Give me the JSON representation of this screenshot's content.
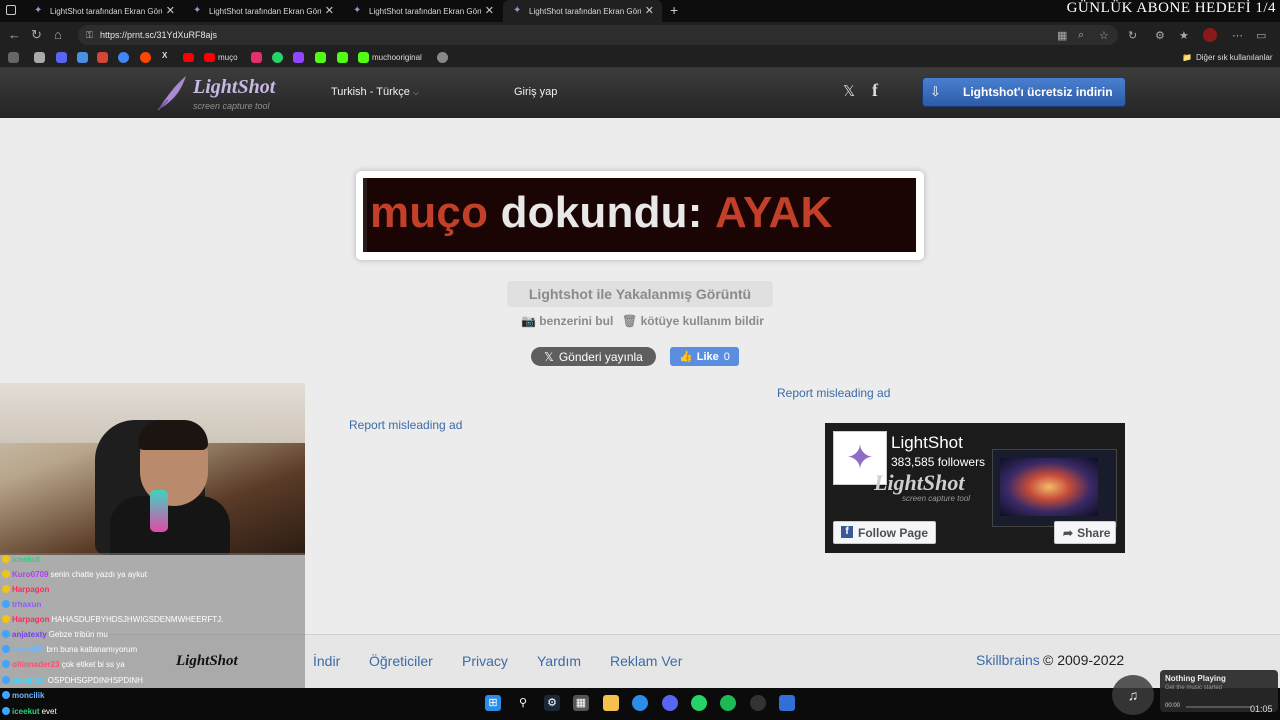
{
  "browser": {
    "tabs": [
      {
        "label": "LightShot tarafından Ekran Görün"
      },
      {
        "label": "LightShot tarafından Ekran Görün"
      },
      {
        "label": "LightShot tarafından Ekran Görün"
      },
      {
        "label": "LightShot tarafından Ekran Görün"
      }
    ],
    "active_tab": 3,
    "url": "https://prnt.sc/31YdXuRF8ajs",
    "bookmarks": [
      {
        "label": "muço"
      },
      {
        "label": "muchooriginal"
      }
    ],
    "other_bookmarks": "Diğer sık kullanılanlar"
  },
  "overlay": {
    "subscriber_goal": "GÜNLÜK ABONE HEDEFİ 1/4"
  },
  "header": {
    "logo_text": "LightShot",
    "logo_sub": "screen capture tool",
    "language": "Turkish - Türkçe",
    "login": "Giriş yap",
    "download": "Lightshot'ı ücretsiz indirin"
  },
  "screenshot": {
    "text_user": "muço",
    "text_middle": "dokundu:",
    "text_item": "AYAK"
  },
  "page": {
    "caption_title": "Lightshot ile Yakalanmış Görüntü",
    "find_similar": "benzerini bul",
    "report_abuse": "kötüye kullanım bildir",
    "x_post": "Gönderi yayınla",
    "like_label": "Like",
    "like_count": "0",
    "report_ad_1": "Report misleading ad",
    "report_ad_2": "Report misleading ad"
  },
  "fb_widget": {
    "page_name": "LightShot",
    "followers": "383,585 followers",
    "watermark": "LightShot",
    "watermark_sub": "screen capture tool",
    "follow_label": "Follow Page",
    "share_label": "Share"
  },
  "footer": {
    "links": [
      "İndir",
      "Öğreticiler",
      "Privacy",
      "Yardım",
      "Reklam Ver"
    ],
    "company": "Skillbrains",
    "copyright": "© 2009-2022"
  },
  "stream_chat": {
    "logo": "LightShot",
    "messages": [
      {
        "user": "iceekut",
        "msg": "",
        "color": "#2fd07a"
      },
      {
        "user": "Kuro0709",
        "msg": "senin chatte yazdı ya aykut",
        "color": "#b13bff"
      },
      {
        "user": "Harpagon",
        "msg": "",
        "color": "#ff2b58"
      },
      {
        "user": "trhaxun",
        "msg": "",
        "color": "#8a5cff"
      },
      {
        "user": "Harpagon",
        "msg": "HAHASDUFBYHDSJHWIGSDENMWHEERFTJ.",
        "color": "#ff2b58"
      },
      {
        "user": "anjatexty",
        "msg": "Gebze tribün mu",
        "color": "#7b3cff"
      },
      {
        "user": "moncilik",
        "msg": "brn buna katlanamıyorum",
        "color": "#6fb7ff"
      },
      {
        "user": "oltinnader23",
        "msg": "çok etiket bi ss ya",
        "color": "#ff4d6d"
      },
      {
        "user": "Bedir027",
        "msg": "OSPDHSGPDINHSPDINH",
        "color": "#3ed6ff"
      },
      {
        "user": "moncilik",
        "msg": "",
        "color": "#6fb7ff"
      },
      {
        "user": "iceekut",
        "msg": "evet",
        "color": "#2fd07a"
      }
    ]
  },
  "media": {
    "title": "Nothing Playing",
    "subtitle": "Get the music started",
    "time": "00:00"
  },
  "taskbar": {
    "clock": "01:05"
  }
}
